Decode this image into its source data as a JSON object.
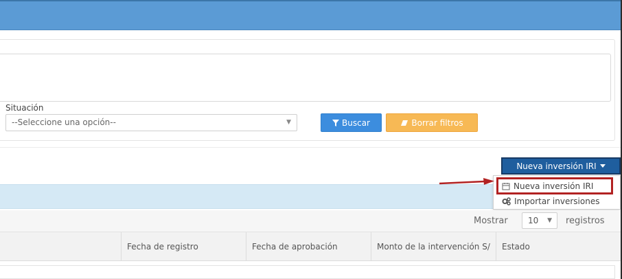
{
  "colors": {
    "header": "#5b9bd5",
    "primary": "#3c8dde",
    "warning": "#f7b955",
    "dark_primary": "#1f5e9e",
    "info_band": "#d5e9f5",
    "highlight": "#b22222"
  },
  "filters": {
    "situacion_label": "Situación",
    "situacion_placeholder": "--Seleccione una opción--",
    "buscar_label": "Buscar",
    "borrar_label": "Borrar filtros"
  },
  "actions": {
    "nueva_button_label": "Nueva inversión IRI",
    "dropdown": [
      {
        "label": "Nueva inversión IRI",
        "icon": "calendar-icon"
      },
      {
        "label": "Importar inversiones",
        "icon": "gears-icon"
      }
    ]
  },
  "table": {
    "mostrar_label": "Mostrar",
    "page_length": "10",
    "registros_label": "registros",
    "columns": [
      "Fecha de registro",
      "Fecha de aprobación",
      "Monto de la intervención S/",
      "Estado"
    ]
  }
}
